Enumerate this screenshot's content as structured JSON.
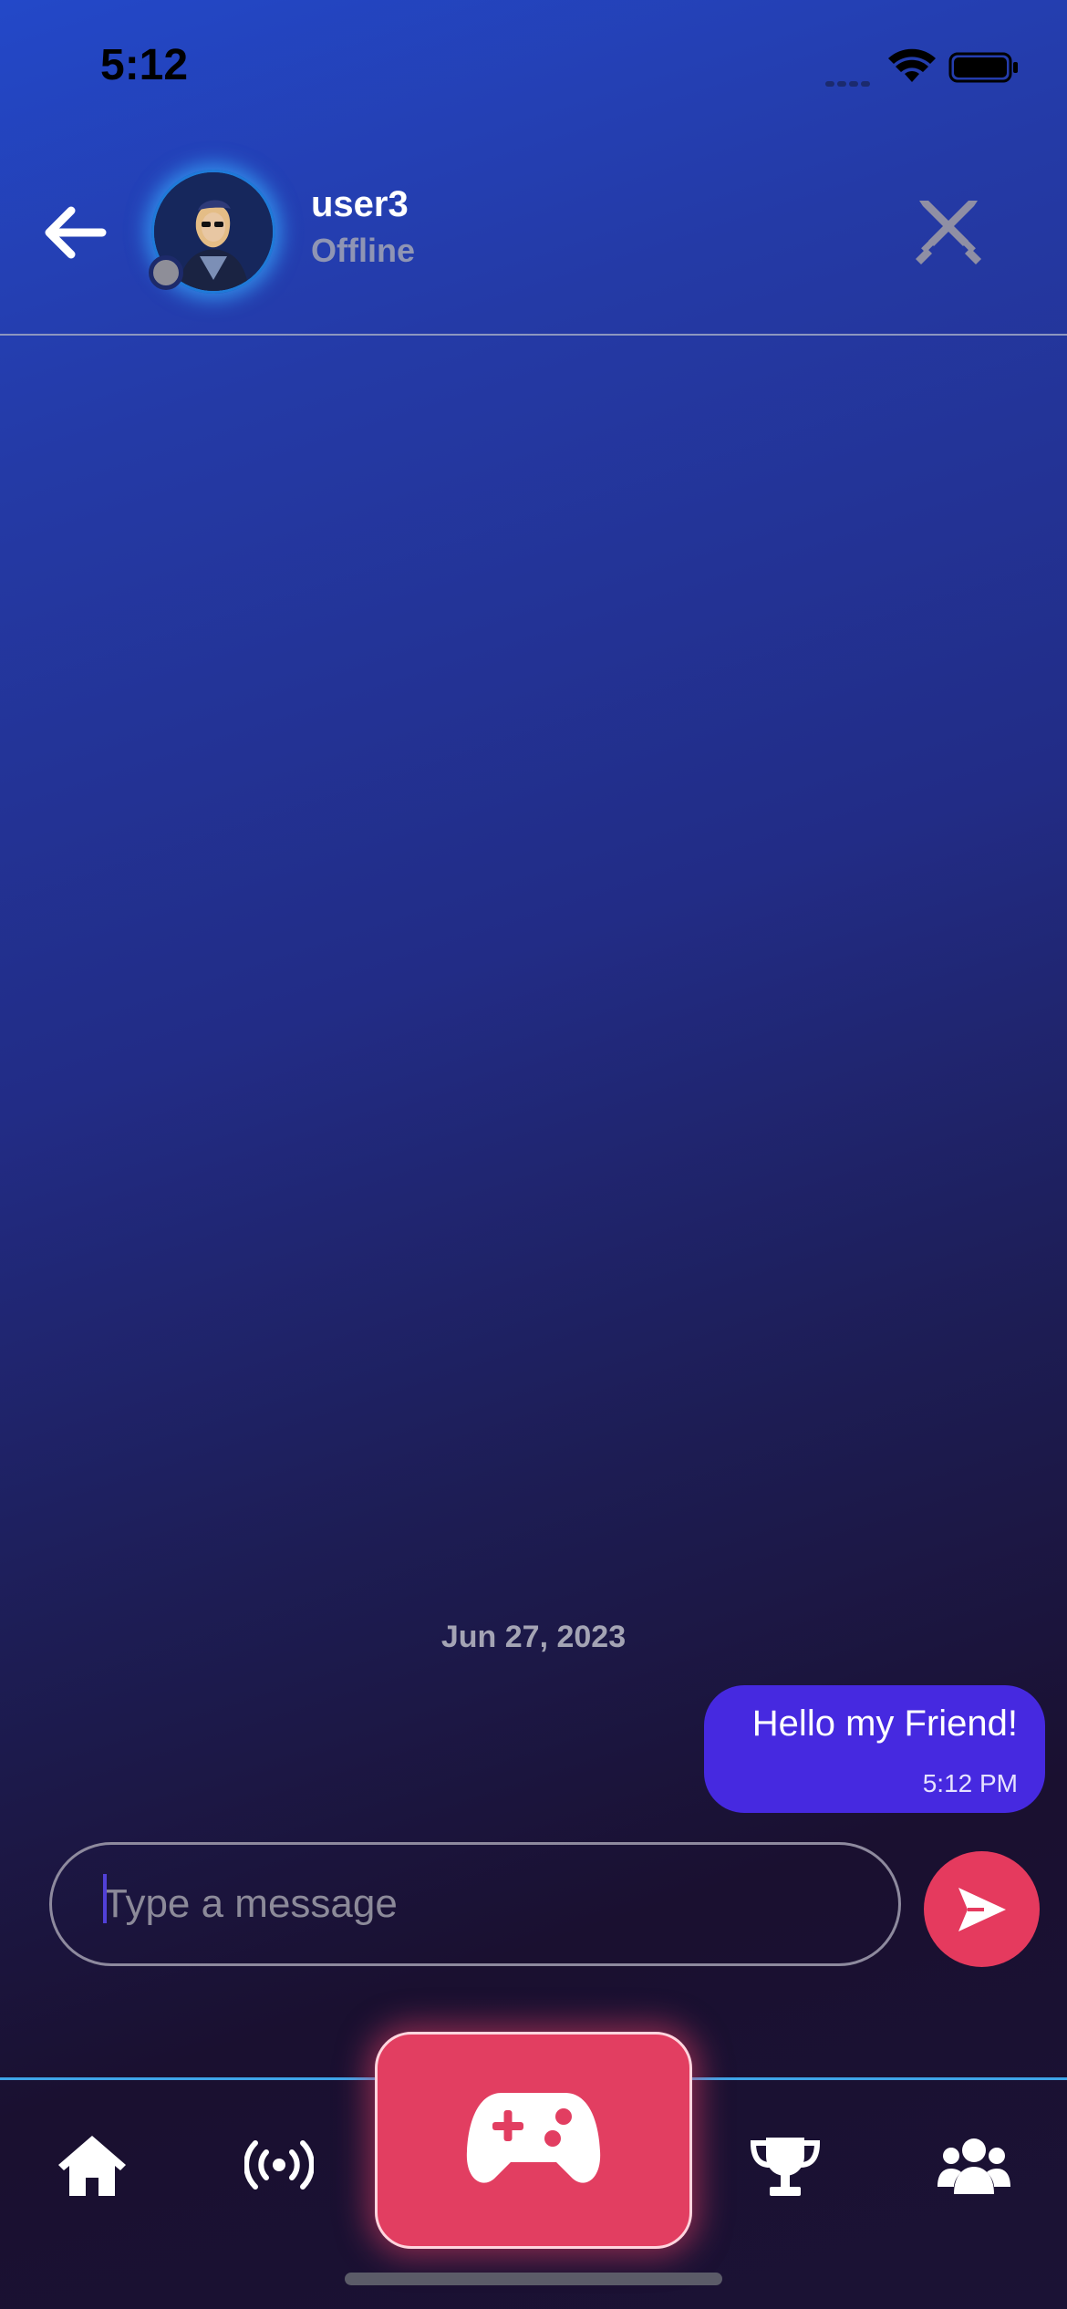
{
  "status_bar": {
    "time": "5:12",
    "icons": [
      "signal-icon",
      "wifi-icon",
      "battery-icon"
    ]
  },
  "header": {
    "back_icon": "arrow-left-icon",
    "username": "user3",
    "presence": "Offline",
    "presence_color": "#8e8e98",
    "action_icon": "crossed-swords-icon"
  },
  "chat": {
    "date_label": "Jun 27, 2023",
    "messages": [
      {
        "text": "Hello my Friend!",
        "time": "5:12 PM",
        "outgoing": true
      }
    ]
  },
  "composer": {
    "value": "",
    "placeholder": "Type a message",
    "send_icon": "send-icon"
  },
  "bottom_nav": {
    "items": [
      {
        "name": "home",
        "icon": "home-icon"
      },
      {
        "name": "live",
        "icon": "broadcast-icon"
      },
      {
        "name": "play",
        "icon": "gamepad-icon"
      },
      {
        "name": "leaderboard",
        "icon": "trophy-icon"
      },
      {
        "name": "friends",
        "icon": "users-icon"
      }
    ]
  },
  "colors": {
    "accent": "#e53a5e",
    "bubble": "#4629e0",
    "avatar_glow": "#38aaff",
    "nav_line": "#3fa5e8"
  }
}
